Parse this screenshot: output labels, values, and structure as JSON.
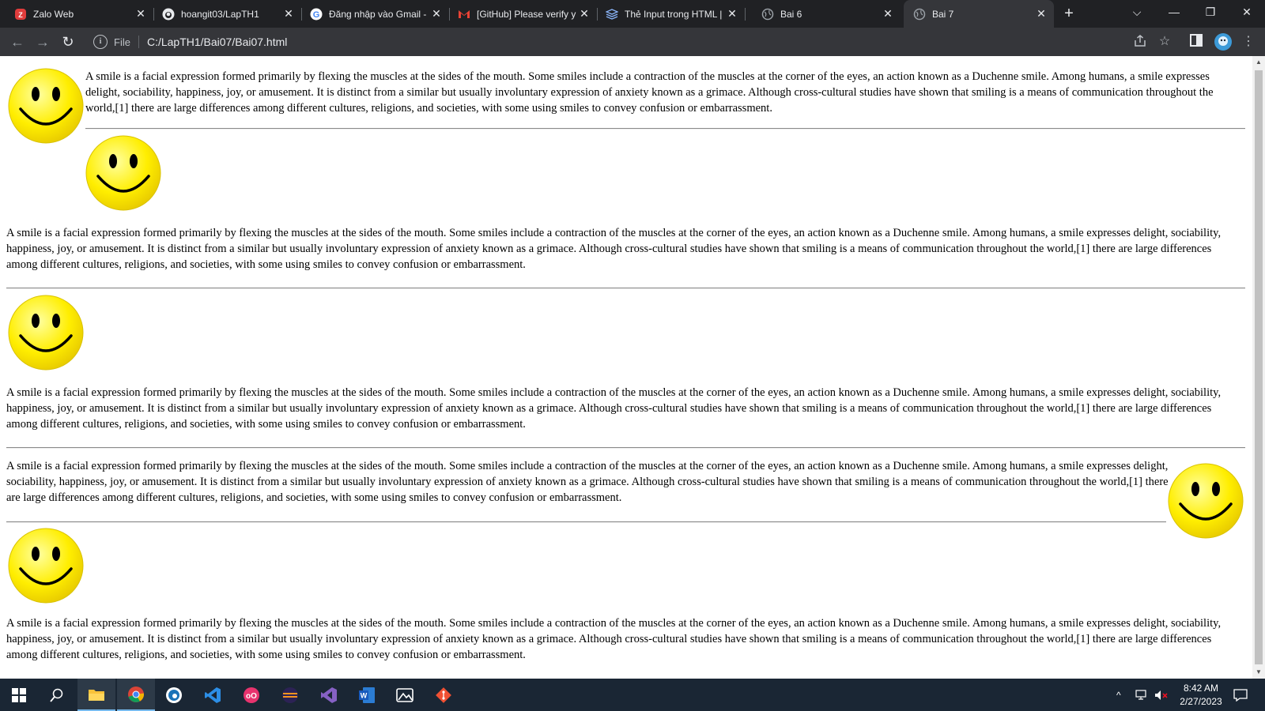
{
  "browser": {
    "tabs": [
      {
        "title": "Zalo Web",
        "icon": "zalo-icon",
        "active": false
      },
      {
        "title": "hoangit03/LapTH1",
        "icon": "github-icon",
        "active": false
      },
      {
        "title": "Đăng nhập vào Gmail -",
        "icon": "google-icon",
        "active": false
      },
      {
        "title": "[GitHub] Please verify y",
        "icon": "gmail-icon",
        "active": false
      },
      {
        "title": "Thẻ Input trong HTML |",
        "icon": "layers-icon",
        "active": false
      },
      {
        "title": "Bai 6",
        "icon": "globe-icon",
        "active": false
      },
      {
        "title": "Bai 7",
        "icon": "globe-icon",
        "active": true
      }
    ],
    "address": {
      "scheme_label": "File",
      "url": "C:/LapTH1/Bai07/Bai07.html"
    },
    "colors": {
      "chrome_dark": "#202124",
      "toolbar": "#35363a",
      "text": "#e8eaed"
    }
  },
  "page": {
    "paragraphs": [
      "A smile is a facial expression formed primarily by flexing the muscles at the sides of the mouth. Some smiles include a contraction of the muscles at the corner of the eyes, an action known as a Duchenne smile. Among humans, a smile expresses delight, sociability, happiness, joy, or amusement. It is distinct from a similar but usually involuntary expression of anxiety known as a grimace. Although cross-cultural studies have shown that smiling is a means of communication throughout the world,[1] there are large differences among different cultures, religions, and societies, with some using smiles to convey confusion or embarrassment.",
      "A smile is a facial expression formed primarily by flexing the muscles at the sides of the mouth. Some smiles include a contraction of the muscles at the corner of the eyes, an action known as a Duchenne smile. Among humans, a smile expresses delight, sociability, happiness, joy, or amusement. It is distinct from a similar but usually involuntary expression of anxiety known as a grimace. Although cross-cultural studies have shown that smiling is a means of communication throughout the world,[1] there are large differences among different cultures, religions, and societies, with some using smiles to convey confusion or embarrassment.",
      "A smile is a facial expression formed primarily by flexing the muscles at the sides of the mouth. Some smiles include a contraction of the muscles at the corner of the eyes, an action known as a Duchenne smile. Among humans, a smile expresses delight, sociability, happiness, joy, or amusement. It is distinct from a similar but usually involuntary expression of anxiety known as a grimace. Although cross-cultural studies have shown that smiling is a means of communication throughout the world,[1] there are large differences among different cultures, religions, and societies, with some using smiles to convey confusion or embarrassment.",
      "A smile is a facial expression formed primarily by flexing the muscles at the sides of the mouth. Some smiles include a contraction of the muscles at the corner of the eyes, an action known as a Duchenne smile. Among humans, a smile expresses delight, sociability, happiness, joy, or amusement. It is distinct from a similar but usually involuntary expression of anxiety known as a grimace. Although cross-cultural studies have shown that smiling is a means of communication throughout the world,[1] there are large differences among different cultures, religions, and societies, with some using smiles to convey confusion or embarrassment.",
      "A smile is a facial expression formed primarily by flexing the muscles at the sides of the mouth. Some smiles include a contraction of the muscles at the corner of the eyes, an action known as a Duchenne smile. Among humans, a smile expresses delight, sociability, happiness, joy, or amusement. It is distinct from a similar but usually involuntary expression of anxiety known as a grimace. Although cross-cultural studies have shown that smiling is a means of communication throughout the world,[1] there are large differences among different cultures, religions, and societies, with some using smiles to convey confusion or embarrassment."
    ],
    "image_icon": "smiley-face-icon",
    "smiley_color": "#ffee00"
  },
  "taskbar": {
    "apps": [
      "windows-start-icon",
      "search-icon",
      "file-explorer-icon",
      "chrome-icon",
      "edge-icon",
      "vscode-icon",
      "app-oo-icon",
      "eclipse-icon",
      "visual-studio-icon",
      "word-icon",
      "photos-icon",
      "git-icon"
    ],
    "clock": {
      "time": "8:42 AM",
      "date": "2/27/2023"
    }
  }
}
